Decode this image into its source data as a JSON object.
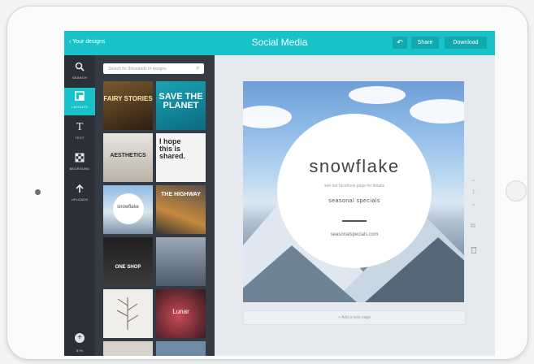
{
  "header": {
    "back_label": "‹ Your designs",
    "title": "Social Media",
    "undo_icon": "undo-icon",
    "share_label": "Share",
    "download_label": "Download"
  },
  "sidebar": {
    "items": [
      {
        "label": "SEARCH",
        "icon": "magnifier-icon"
      },
      {
        "label": "LAYOUTS",
        "icon": "layout-icon"
      },
      {
        "label": "TEXT",
        "icon": "text-icon"
      },
      {
        "label": "BKGROUND",
        "icon": "background-icon"
      },
      {
        "label": "UPLOADS",
        "icon": "upload-icon"
      }
    ],
    "zoom_level": "57%"
  },
  "templates": {
    "search_placeholder": "Search for thousands of designs",
    "tiles": [
      {
        "text": "FAIRY STORIES"
      },
      {
        "text": "SAVE THE PLANET"
      },
      {
        "text": "AESTHETICS"
      },
      {
        "text": "I hope this is shared."
      },
      {
        "text": "snowflake"
      },
      {
        "text": "THE HIGHWAY"
      },
      {
        "text": "ONE SHOP"
      },
      {
        "text": ""
      },
      {
        "text": ""
      },
      {
        "text": "Lunar"
      }
    ]
  },
  "design": {
    "title": "snowflake",
    "subtitle": "see our facebook page for details",
    "tagline": "seasonal specials",
    "url": "seasonalspecials.com"
  },
  "canvas": {
    "add_page_label": "+ Add a new page",
    "page_number": "1"
  },
  "colors": {
    "accent": "#19c2c8",
    "nav_background": "#2b3036",
    "panel_background": "#353b42"
  }
}
